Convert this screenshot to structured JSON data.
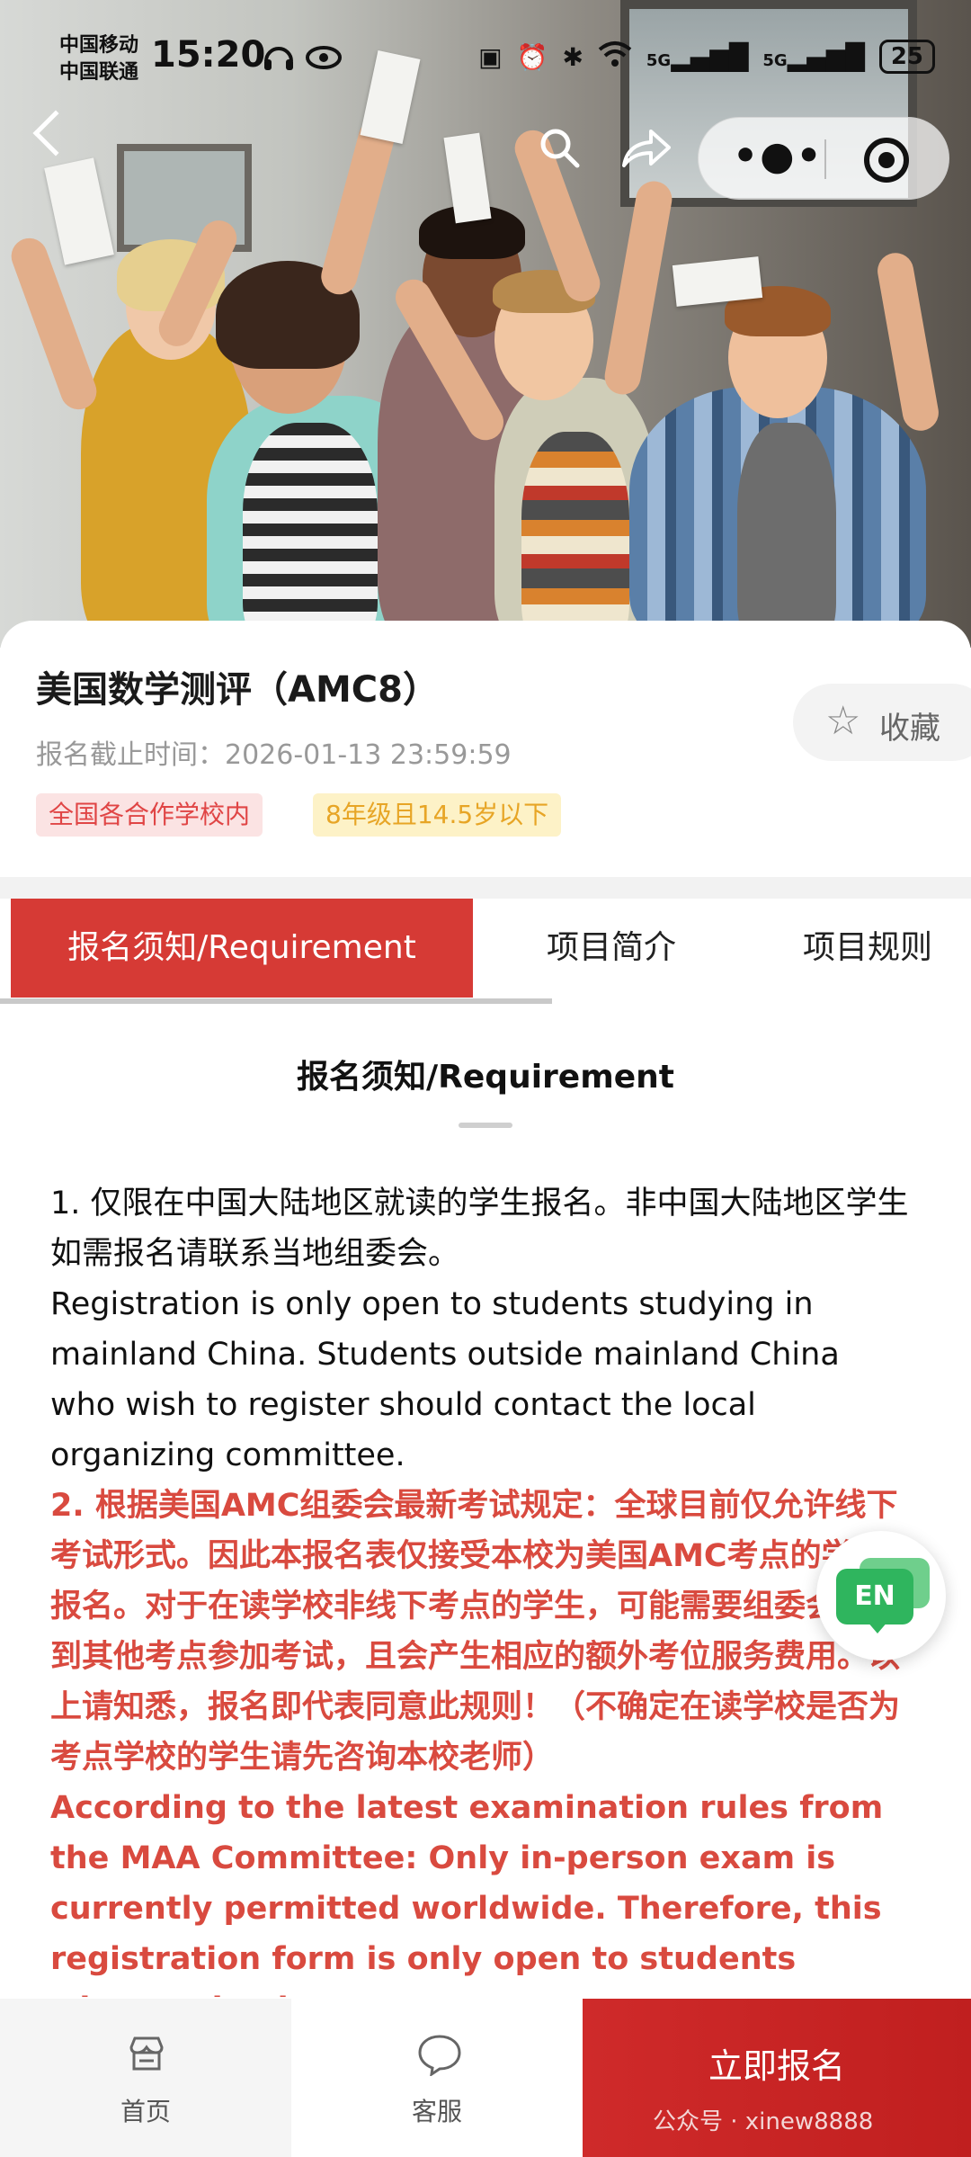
{
  "status_bar": {
    "carrier_1": "中国移动",
    "carrier_2": "中国联通",
    "time": "15:20",
    "network_1": "5G",
    "network_2": "5G",
    "battery": "25"
  },
  "event": {
    "title": "美国数学测评（AMC8）",
    "deadline": "报名截止时间：2026-01-13 23:59:59",
    "tags": [
      "全国各合作学校内",
      "8年级且14.5岁以下"
    ],
    "favorite_label": "收藏"
  },
  "tabs": [
    {
      "label": "报名须知/Requirement",
      "active": true
    },
    {
      "label": "项目简介",
      "active": false
    },
    {
      "label": "项目规则",
      "active": false
    }
  ],
  "section": {
    "title": "报名须知/Requirement",
    "para_1_cn": "1. 仅限在中国大陆地区就读的学生报名。非中国大陆地区学生如需报名请联系当地组委会。",
    "para_1_en": "Registration is only open to students studying in mainland China. Students outside mainland China who wish to register should contact the local organizing committee.",
    "para_2_cn": "2. 根据美国AMC组委会最新考试规定：全球目前仅允许线下考试形式。因此本报名表仅接受本校为美国AMC考点的学生报名。对于在读学校非线下考点的学生，可能需要组委会协调到其他考点参加考试，且会产生相应的额外考位服务费用。以上请知悉，报名即代表同意此规则！（不确定在读学校是否为考点学校的学生请先咨询本校老师）",
    "para_2_en": "According to the latest examination rules from the MAA Committee: Only in-person exam is currently permitted worldwide. Therefore, this registration form is only open to students whose schools are"
  },
  "floating_button": {
    "label": "EN"
  },
  "bottom_bar": {
    "home": "首页",
    "service": "客服",
    "signup": "立即报名",
    "watermark": "公众号 · xinew8888"
  },
  "colors": {
    "accent_red": "#d63a35",
    "tag_red_bg": "#fbe3e3",
    "tag_yellow_bg": "#fdf2c7",
    "en_green": "#2fb55e"
  }
}
